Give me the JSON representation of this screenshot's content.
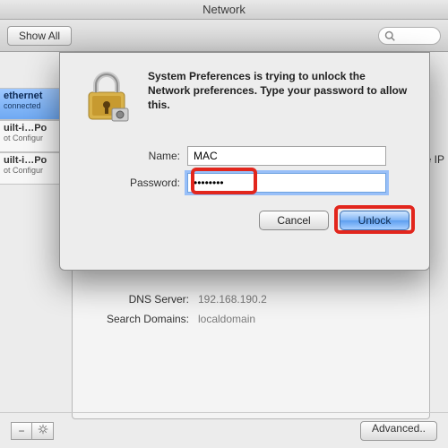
{
  "window": {
    "title": "Network"
  },
  "toolbar": {
    "show_all": "Show All",
    "search_placeholder": ""
  },
  "sidebar": {
    "items": [
      {
        "name": "ethernet",
        "status": "connected"
      },
      {
        "name": "uilt-i…Po",
        "status": "ot Configur"
      },
      {
        "name": "uilt-i…Po",
        "status": "ot Configur"
      }
    ]
  },
  "content": {
    "ip_fragment": "the IP",
    "dns_label": "DNS Server:",
    "dns_value": "192.168.190.2",
    "search_label": "Search Domains:",
    "search_value": "localdomain",
    "advanced": "Advanced.."
  },
  "footer": {
    "minus": "−",
    "gear": "✱"
  },
  "dialog": {
    "message": "System Preferences is trying to unlock the Network preferences. Type your password to allow this.",
    "name_label": "Name:",
    "name_value": "MAC",
    "password_label": "Password:",
    "password_value": "••••••••",
    "cancel": "Cancel",
    "unlock": "Unlock"
  }
}
